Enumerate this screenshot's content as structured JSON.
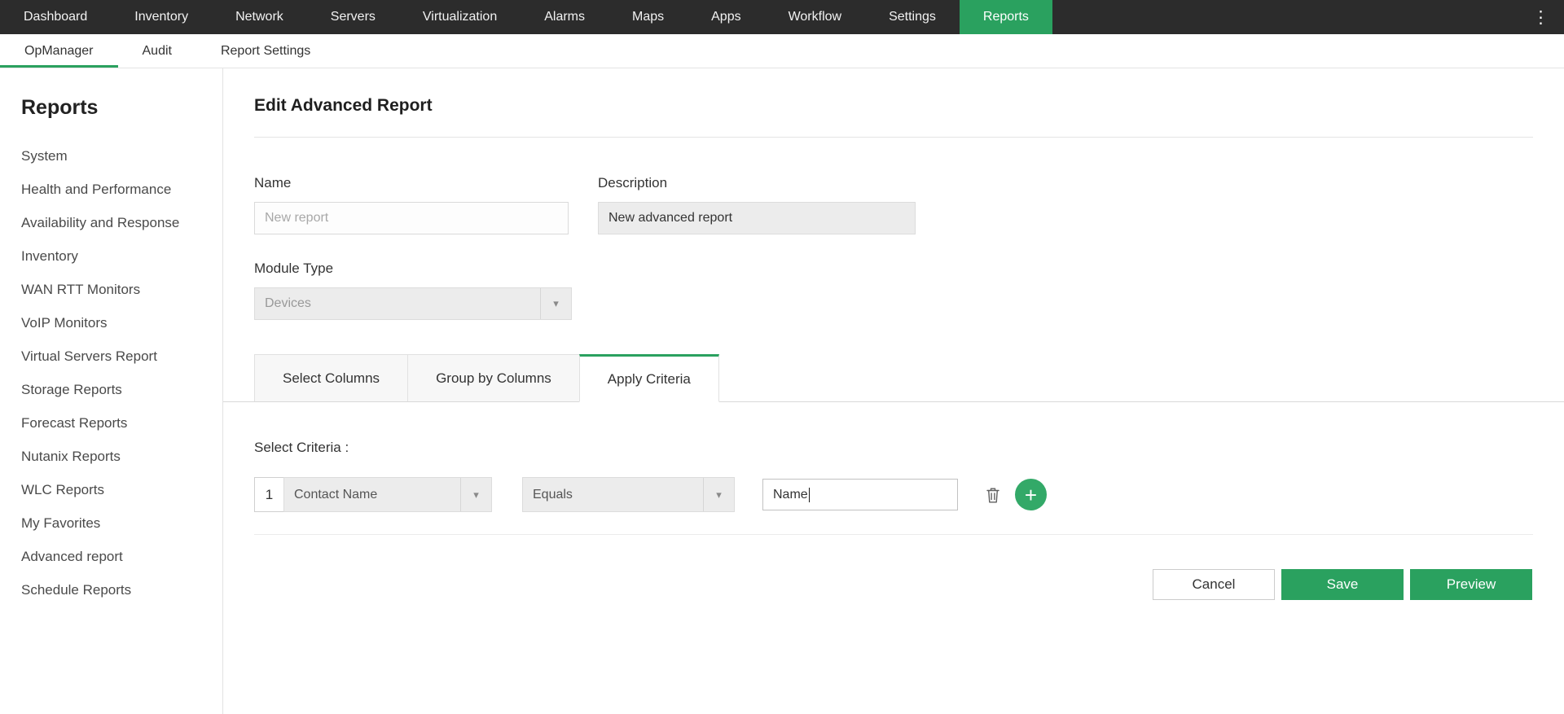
{
  "topnav": {
    "items": [
      "Dashboard",
      "Inventory",
      "Network",
      "Servers",
      "Virtualization",
      "Alarms",
      "Maps",
      "Apps",
      "Workflow",
      "Settings",
      "Reports"
    ],
    "active_item": "Reports"
  },
  "subnav": {
    "items": [
      "OpManager",
      "Audit",
      "Report Settings"
    ],
    "active_item": "OpManager"
  },
  "sidebar": {
    "title": "Reports",
    "items": [
      "System",
      "Health and Performance",
      "Availability and Response",
      "Inventory",
      "WAN RTT Monitors",
      "VoIP Monitors",
      "Virtual Servers Report",
      "Storage Reports",
      "Forecast Reports",
      "Nutanix Reports",
      "WLC Reports",
      "My Favorites",
      "Advanced report",
      "Schedule Reports"
    ]
  },
  "main": {
    "title": "Edit Advanced Report",
    "form": {
      "name_label": "Name",
      "name_value": "",
      "name_placeholder": "New report",
      "description_label": "Description",
      "description_value": "New advanced report",
      "module_type_label": "Module Type",
      "module_type_value": "Devices"
    },
    "tabs": [
      "Select Columns",
      "Group by Columns",
      "Apply Criteria"
    ],
    "active_tab": "Apply Criteria",
    "criteria": {
      "label": "Select Criteria :",
      "rows": [
        {
          "index": "1",
          "column": "Contact Name",
          "operator": "Equals",
          "value": "Name"
        }
      ]
    },
    "actions": {
      "cancel": "Cancel",
      "save": "Save",
      "preview": "Preview"
    }
  },
  "icons": {
    "kebab": "⋮",
    "chevron_down": "▾",
    "plus": "+"
  },
  "colors": {
    "accent_green": "#2aa15f",
    "topbar_bg": "#2c2c2c"
  }
}
